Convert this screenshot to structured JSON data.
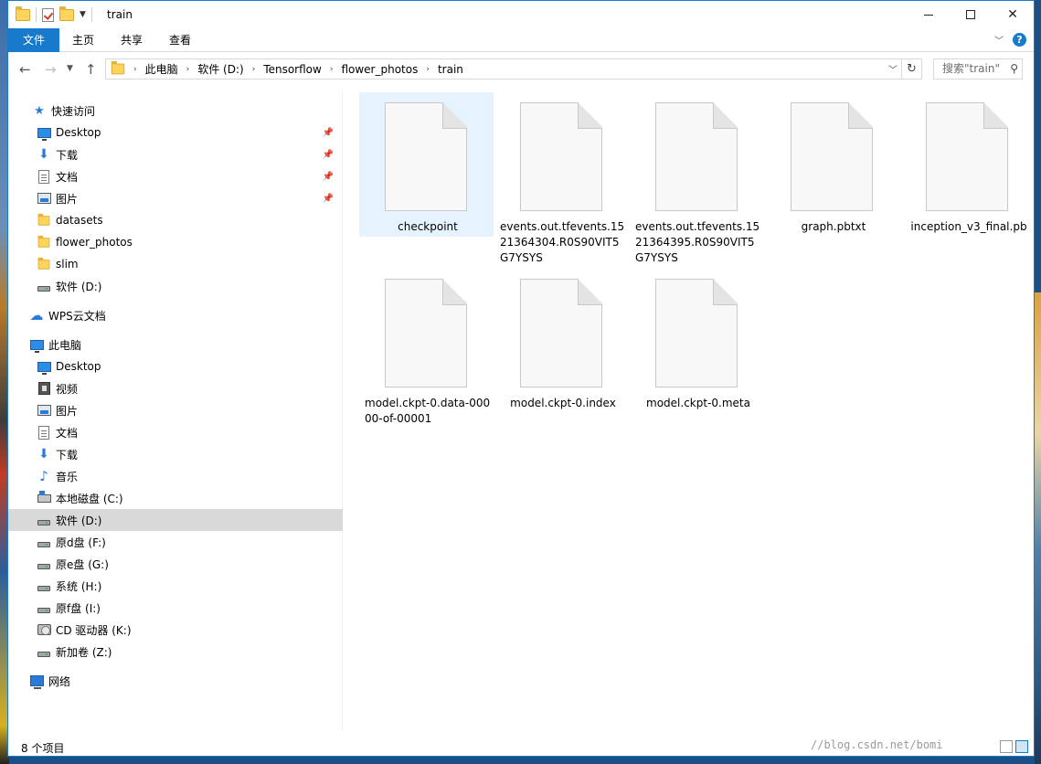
{
  "window": {
    "title": "train"
  },
  "ribbon": {
    "tabs": [
      "文件",
      "主页",
      "共享",
      "查看"
    ]
  },
  "address": {
    "crumbs": [
      "此电脑",
      "软件 (D:)",
      "Tensorflow",
      "flower_photos",
      "train"
    ]
  },
  "search": {
    "placeholder": "搜索\"train\""
  },
  "sidebar": {
    "quick_access": "快速访问",
    "pinned": [
      {
        "label": "Desktop",
        "icon": "desktop-icon"
      },
      {
        "label": "下载",
        "icon": "download-icon"
      },
      {
        "label": "文档",
        "icon": "document-icon"
      },
      {
        "label": "图片",
        "icon": "picture-icon"
      }
    ],
    "folders": [
      "datasets",
      "flower_photos",
      "slim"
    ],
    "quick_drive": "软件 (D:)",
    "wps": "WPS云文档",
    "this_pc": "此电脑",
    "pc_items": [
      {
        "label": "Desktop",
        "icon": "desktop-icon"
      },
      {
        "label": "视频",
        "icon": "video-icon"
      },
      {
        "label": "图片",
        "icon": "picture-icon"
      },
      {
        "label": "文档",
        "icon": "document-icon"
      },
      {
        "label": "下载",
        "icon": "download-icon"
      },
      {
        "label": "音乐",
        "icon": "music-icon"
      },
      {
        "label": "本地磁盘 (C:)",
        "icon": "system-drive-icon"
      },
      {
        "label": "软件 (D:)",
        "icon": "drive-icon"
      },
      {
        "label": "原d盘 (F:)",
        "icon": "drive-icon"
      },
      {
        "label": "原e盘 (G:)",
        "icon": "drive-icon"
      },
      {
        "label": "系统 (H:)",
        "icon": "drive-icon"
      },
      {
        "label": "原f盘 (I:)",
        "icon": "drive-icon"
      },
      {
        "label": "CD 驱动器 (K:)",
        "icon": "cd-drive-icon"
      },
      {
        "label": "新加卷 (Z:)",
        "icon": "drive-icon"
      }
    ],
    "network": "网络"
  },
  "files": [
    {
      "name": "checkpoint"
    },
    {
      "name": "events.out.tfevents.1521364304.R0S90VIT5G7YSYS"
    },
    {
      "name": "events.out.tfevents.1521364395.R0S90VIT5G7YSYS"
    },
    {
      "name": "graph.pbtxt"
    },
    {
      "name": "inception_v3_final.pb"
    },
    {
      "name": "model.ckpt-0.data-00000-of-00001"
    },
    {
      "name": "model.ckpt-0.index"
    },
    {
      "name": "model.ckpt-0.meta"
    }
  ],
  "status": {
    "count": "8 个项目"
  },
  "watermark": "//blog.csdn.net/bomi"
}
